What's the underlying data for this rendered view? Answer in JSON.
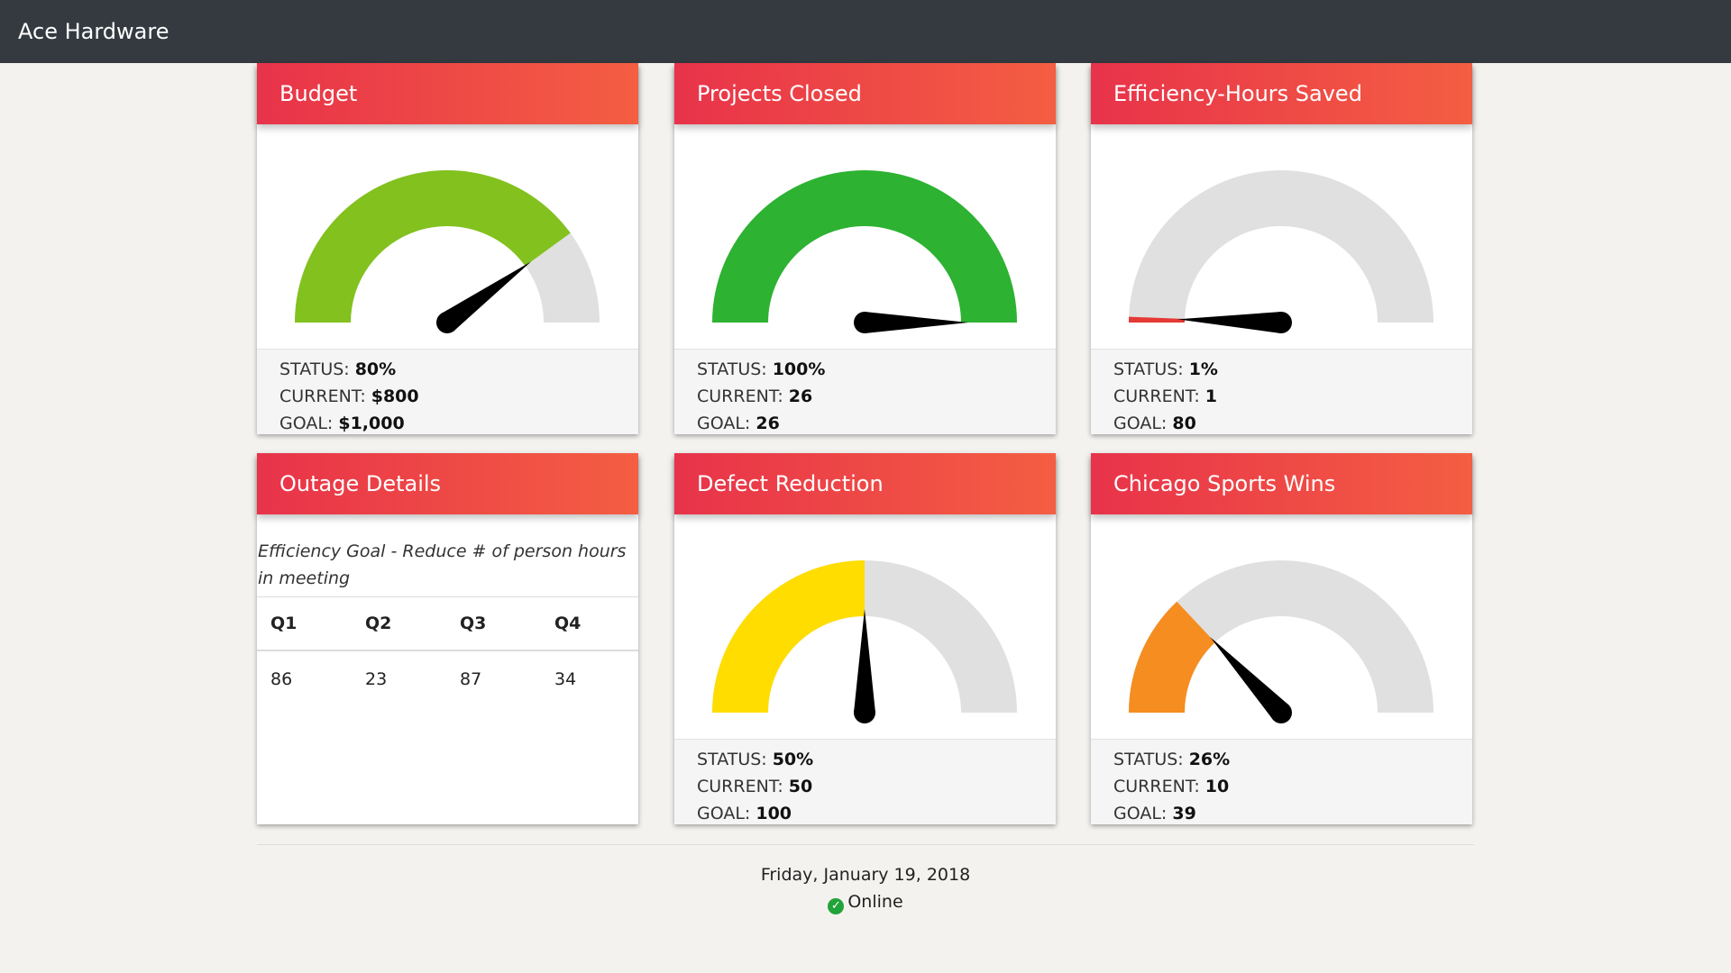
{
  "app": {
    "title": "Ace Hardware"
  },
  "colors": {
    "track": "#e0e0e0",
    "needle": "#000000",
    "header_gradient": [
      "#e8334a",
      "#f45e42"
    ]
  },
  "cards": [
    {
      "title": "Budget",
      "status_label": "STATUS:",
      "status": "80%",
      "current_label": "CURRENT:",
      "current": "$800",
      "goal_label": "GOAL:",
      "goal": "$1,000",
      "fraction": 0.8,
      "color": "#82c11e"
    },
    {
      "title": "Projects Closed",
      "status_label": "STATUS:",
      "status": "100%",
      "current_label": "CURRENT:",
      "current": "26",
      "goal_label": "GOAL:",
      "goal": "26",
      "fraction": 1.0,
      "color": "#2db232"
    },
    {
      "title": "Efficiency-Hours Saved",
      "status_label": "STATUS:",
      "status": "1%",
      "current_label": "CURRENT:",
      "current": "1",
      "goal_label": "GOAL:",
      "goal": "80",
      "fraction": 0.01,
      "color": "#e53935"
    },
    {
      "title": "Defect Reduction",
      "status_label": "STATUS:",
      "status": "50%",
      "current_label": "CURRENT:",
      "current": "50",
      "goal_label": "GOAL:",
      "goal": "100",
      "fraction": 0.5,
      "color": "#ffdd00"
    },
    {
      "title": "Chicago Sports Wins",
      "status_label": "STATUS:",
      "status": "26%",
      "current_label": "CURRENT:",
      "current": "10",
      "goal_label": "GOAL:",
      "goal": "39",
      "fraction": 0.26,
      "color": "#f58d20"
    }
  ],
  "outage": {
    "title": "Outage Details",
    "description": "Efficiency Goal - Reduce # of person hours in meeting",
    "headers": [
      "Q1",
      "Q2",
      "Q3",
      "Q4"
    ],
    "values": [
      "86",
      "23",
      "87",
      "34"
    ]
  },
  "footer": {
    "date": "Friday, January 19, 2018",
    "status": "Online",
    "status_icon": "check-circle-icon"
  }
}
